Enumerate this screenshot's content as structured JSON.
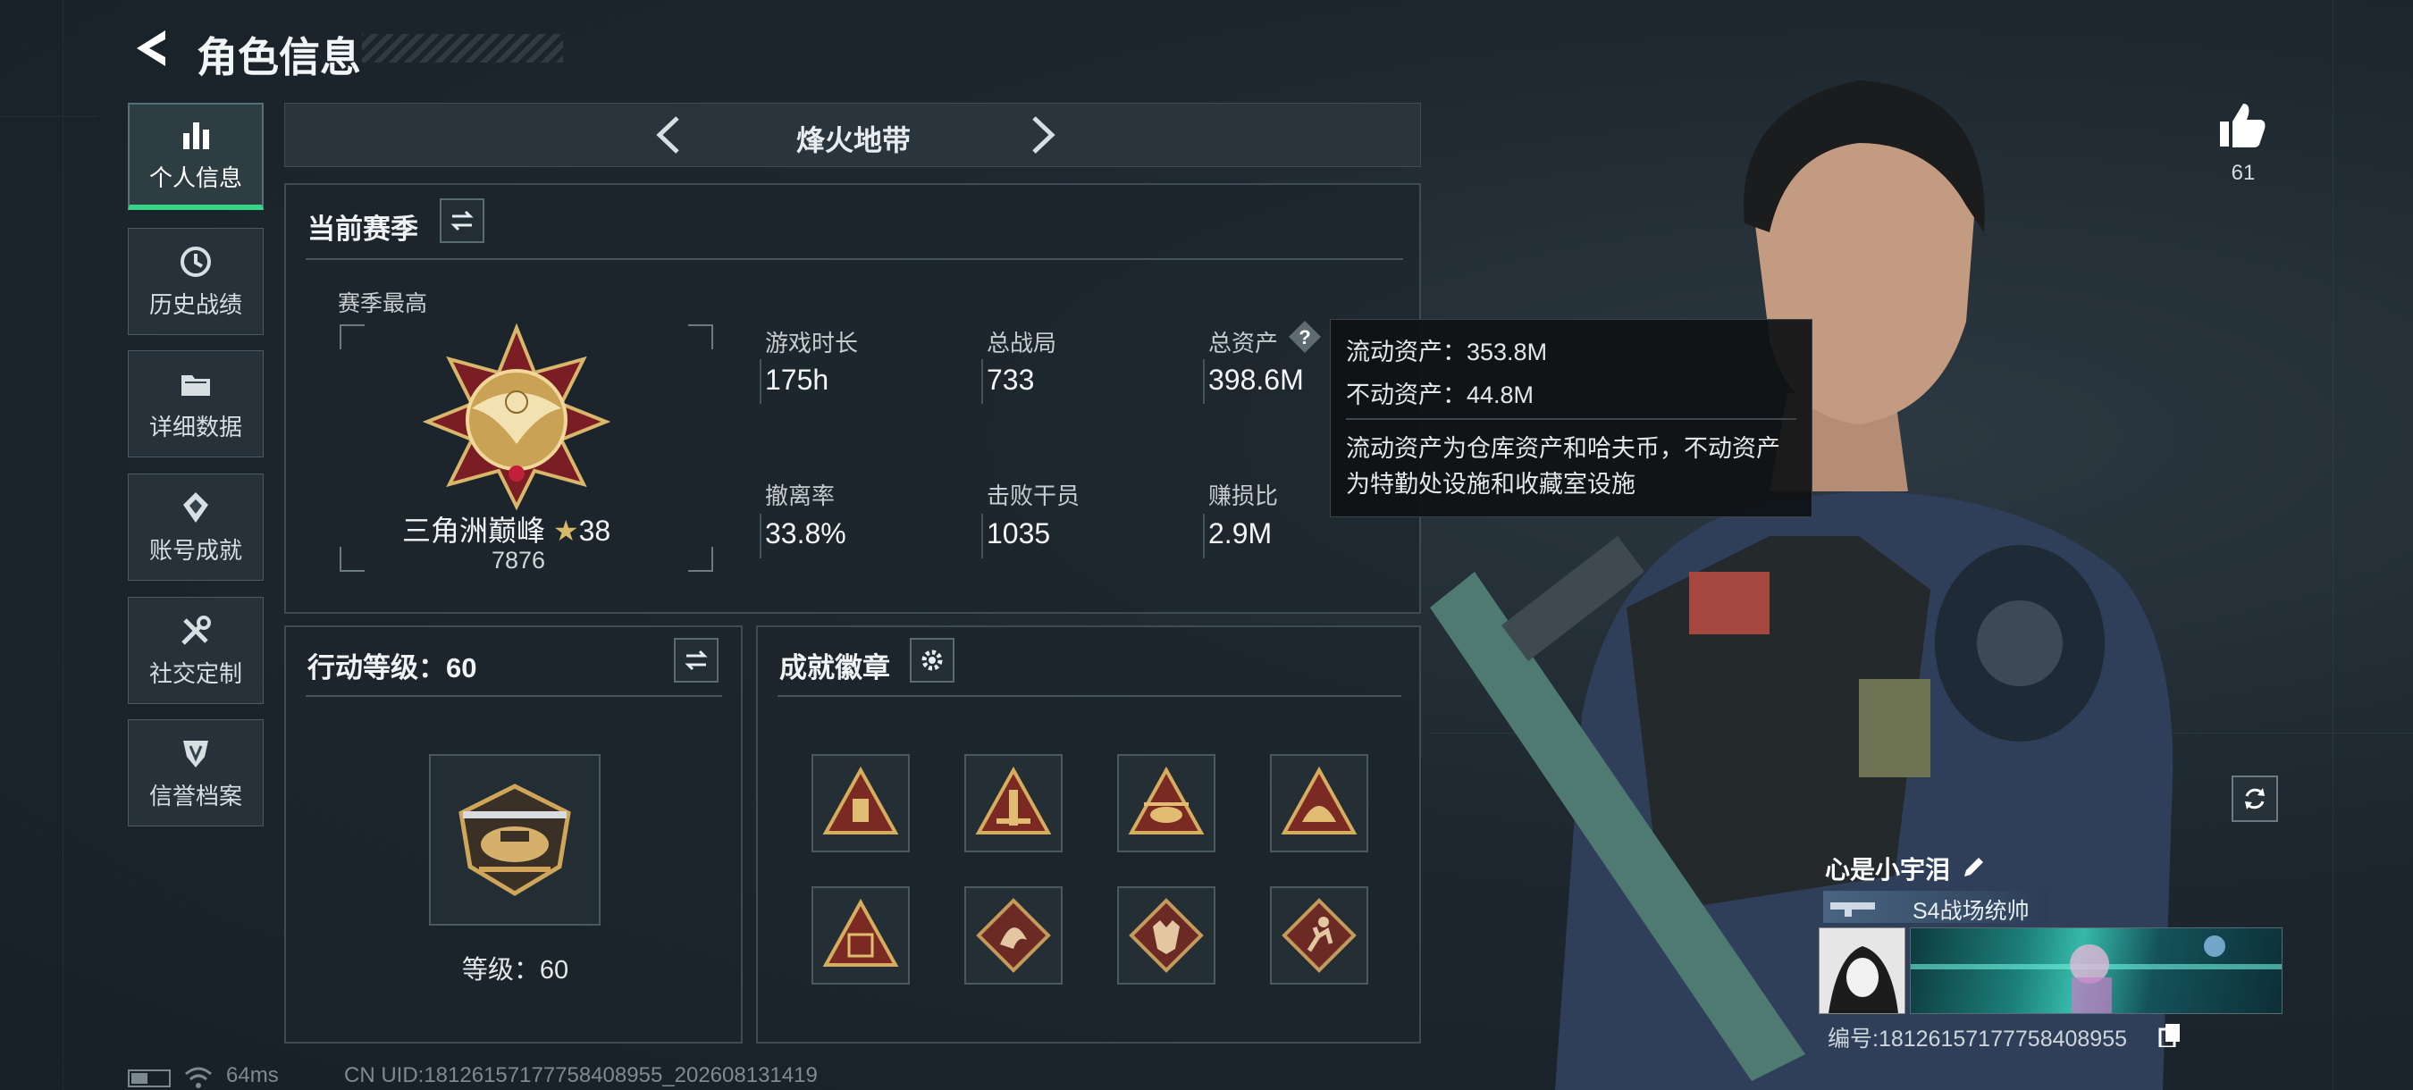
{
  "header": {
    "title": "角色信息"
  },
  "sidebar": {
    "items": [
      {
        "label": "个人信息",
        "icon": "bar-chart-icon",
        "active": true
      },
      {
        "label": "历史战绩",
        "icon": "history-icon"
      },
      {
        "label": "详细数据",
        "icon": "folder-icon"
      },
      {
        "label": "账号成就",
        "icon": "achievement-icon"
      },
      {
        "label": "社交定制",
        "icon": "tools-icon"
      },
      {
        "label": "信誉档案",
        "icon": "credit-shield-icon"
      }
    ]
  },
  "mode_selector": {
    "label": "烽火地带"
  },
  "season": {
    "title": "当前赛季",
    "best_label": "赛季最高",
    "rank_name": "三角洲巅峰",
    "rank_stars": "38",
    "rank_score": "7876",
    "stats": [
      {
        "label": "游戏时长",
        "value": "175h"
      },
      {
        "label": "总战局",
        "value": "733"
      },
      {
        "label": "总资产",
        "value": "398.6M"
      },
      {
        "label": "撤离率",
        "value": "33.8%"
      },
      {
        "label": "击败干员",
        "value": "1035"
      },
      {
        "label": "赚损比",
        "value": "2.9M"
      }
    ]
  },
  "tooltip": {
    "liquid": "流动资产：353.8M",
    "fixed": "不动资产：44.8M",
    "desc_line1": "流动资产为仓库资产和哈夫币，不动资产",
    "desc_line2": "为特勤处设施和收藏室设施"
  },
  "action_level": {
    "title": "行动等级：60",
    "level_text": "等级：60"
  },
  "achievements": {
    "title": "成就徽章",
    "badges": [
      "badge-supply-icon",
      "badge-weapon-icon",
      "badge-helicopter-icon",
      "badge-helmet-icon",
      "badge-s8-icon",
      "badge-dragon-icon",
      "badge-wolf-icon",
      "badge-runner-icon"
    ]
  },
  "profile": {
    "likes": "61",
    "player_name": "心是小宇泪",
    "rank_title": "S4战场统帅",
    "player_id": "编号:18126157177758408955"
  },
  "footer": {
    "ping": "64ms",
    "uid": "CN UID:18126157177758408955_202608131419"
  },
  "colors": {
    "accent_green": "#35d68a",
    "gold": "#c9a45a",
    "panel_bg": "#1c252c"
  }
}
